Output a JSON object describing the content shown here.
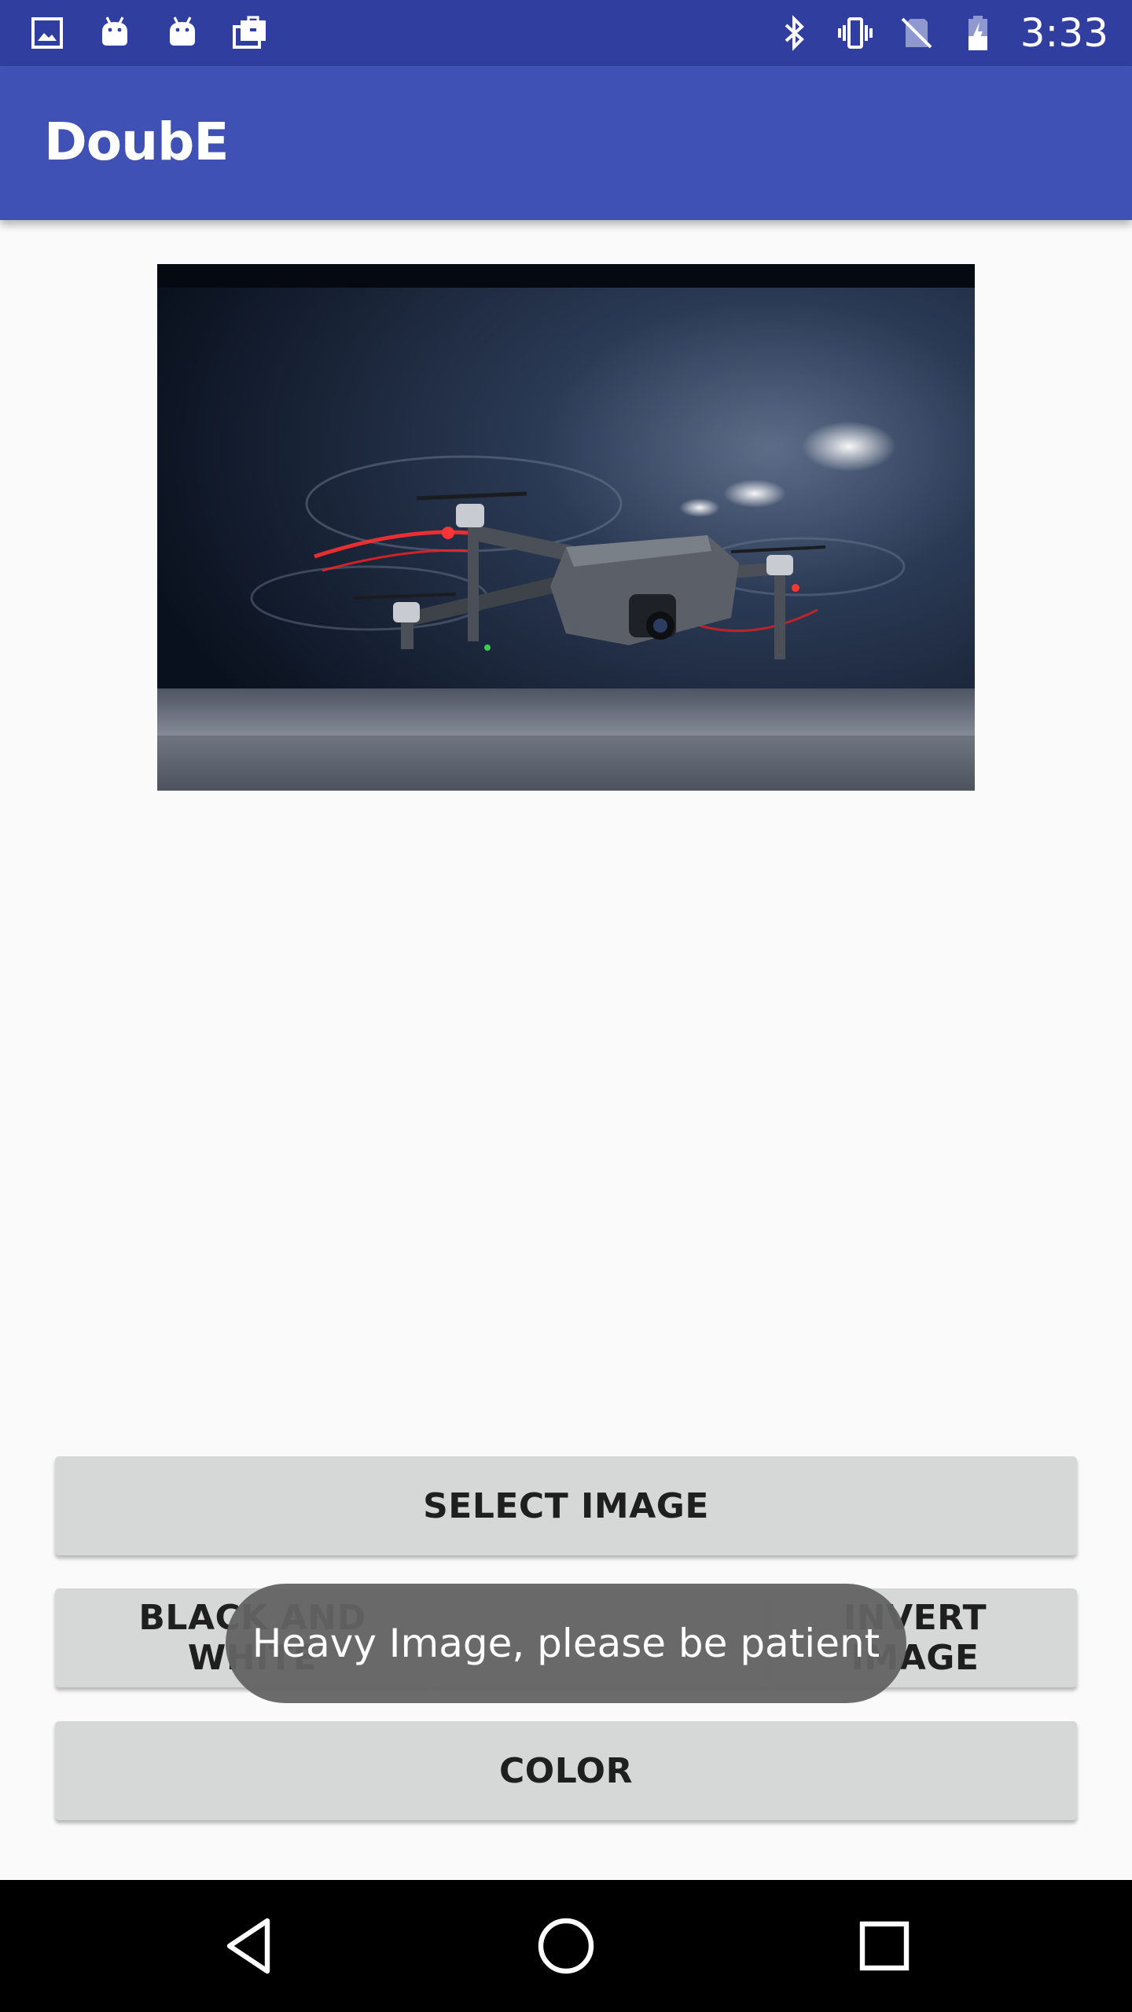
{
  "status_bar": {
    "time": "3:33",
    "left_icons": [
      "image-icon",
      "android-icon",
      "android-icon",
      "briefcase-icon"
    ],
    "right_icons": [
      "bluetooth-icon",
      "vibrate-icon",
      "no-sim-icon",
      "battery-charging-icon"
    ]
  },
  "app_bar": {
    "title": "DoubE"
  },
  "image_preview": {
    "subject": "drone-photo"
  },
  "buttons": {
    "select_image": "SELECT IMAGE",
    "black_and_white": "BLACK AND WHITE",
    "invert_image": "INVERT IMAGE",
    "color": "COLOR"
  },
  "toast": {
    "message": "Heavy Image, please be patient"
  },
  "nav_bar": {
    "icons": [
      "back-icon",
      "home-icon",
      "recents-icon"
    ]
  },
  "colors": {
    "status_bar": "#303f9f",
    "app_bar": "#3f51b5",
    "background": "#fafafa",
    "button": "#d6d7d7",
    "toast": "#636363"
  }
}
